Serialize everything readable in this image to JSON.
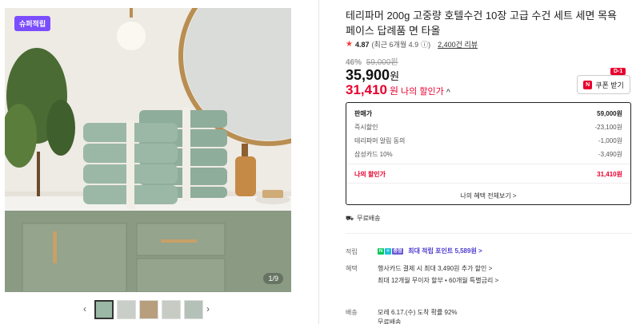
{
  "gallery": {
    "badge": "슈퍼적립",
    "counter": "1/9",
    "prev_icon": "chevron-left-icon",
    "next_icon": "chevron-right-icon",
    "thumb_count": 5,
    "selected_thumb": 1
  },
  "product": {
    "title": "테리파머 200g 고중량 호텔수건 10장 고급 수건 세트 세면 목욕 페이스 답례품 면 타올",
    "rating": "4.87",
    "rating_recent": "(최근 6개월 4.9",
    "rating_info": "ⓘ)",
    "review_count": "2,400건 리뷰"
  },
  "price": {
    "discount_pct": "46%",
    "original": "59,000원",
    "sale": "35,900",
    "sale_unit": "원",
    "my_price": "31,410",
    "my_unit": "원",
    "my_label": "나의 할인가",
    "chev": "^",
    "coupon_dday": "D-1",
    "coupon_label": "쿠폰 받기",
    "coupon_icon_text": "N"
  },
  "breakdown": {
    "rows": [
      {
        "label": "판매가",
        "value": "59,000원"
      },
      {
        "label": "즉시할인",
        "value": "-23,100원"
      },
      {
        "label": "테리파머 알림 동의",
        "value": "-1,000원"
      },
      {
        "label": "삼성카드 10%",
        "value": "-3,490원"
      }
    ],
    "total_label": "나의 할인가",
    "total_value": "31,410원",
    "more": "나의 혜택 전체보기 >"
  },
  "shipping": {
    "label": "무료배송"
  },
  "benefits": {
    "points_label": "적립",
    "points_badge_n": "N",
    "points_badge_plus": "+",
    "points_badge_tag": "증정",
    "points_text": "최대 적립 포인트",
    "points_value": "5,589원 >",
    "benefit_label": "혜택",
    "benefit_line1": "행사카드 결제 시 최대 3,490원 추가 할인 >",
    "benefit_line2": "최대 12개월 무이자 할부 • 60개월 특별금리 >",
    "delivery_label": "배송",
    "delivery_line1": "모레 6.17.(수) 도착 확률 92%",
    "delivery_line2": "무료배송"
  },
  "colors": {
    "accent": "#e8002d",
    "badge": "#7b4dff",
    "points": "#4f3cd0"
  }
}
